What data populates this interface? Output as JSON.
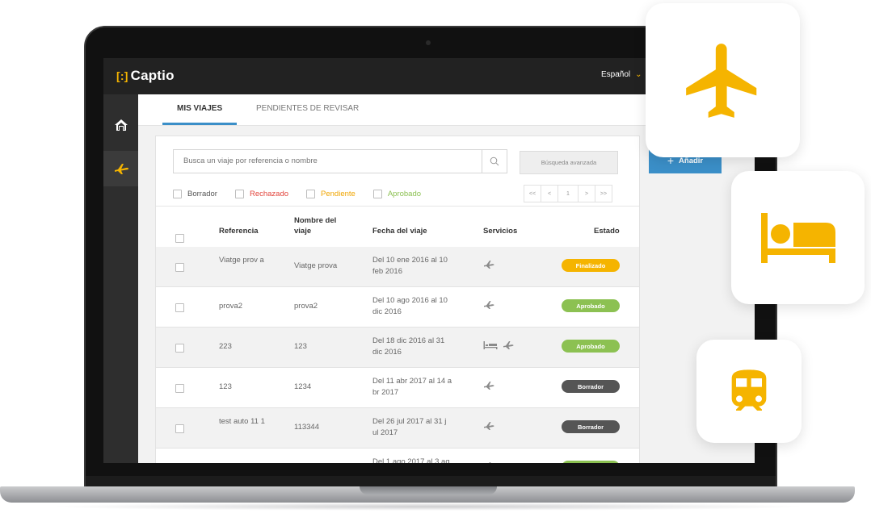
{
  "app": {
    "brand": "Captio",
    "language": "Español"
  },
  "tabs": [
    {
      "label": "MIS VIAJES",
      "active": true
    },
    {
      "label": "PENDIENTES DE REVISAR",
      "active": false
    }
  ],
  "search": {
    "placeholder": "Busca un viaje por referencia o nombre",
    "advanced_label": "Búsqueda avanzada"
  },
  "add_button": {
    "label": "Añadir"
  },
  "filters": [
    {
      "label": "Borrador",
      "color": "#555555"
    },
    {
      "label": "Rechazado",
      "color": "#e2453c"
    },
    {
      "label": "Pendiente",
      "color": "#f0a500"
    },
    {
      "label": "Aprobado",
      "color": "#8cc152"
    }
  ],
  "pagination": {
    "first": "<<",
    "prev": "<",
    "page": "1",
    "next": ">",
    "last": ">>"
  },
  "table": {
    "headers": {
      "reference": "Referencia",
      "name": "Nombre del viaje",
      "date": "Fecha del viaje",
      "services": "Servicios",
      "status": "Estado"
    },
    "rows": [
      {
        "reference": "Viatge prov a",
        "name": "Viatge prova",
        "date": "Del 10 ene 2016 al 10 feb 2016",
        "services": [
          "plane-icon"
        ],
        "status": "Finalizado"
      },
      {
        "reference": "prova2",
        "name": "prova2",
        "date": "Del 10 ago 2016 al 10 dic 2016",
        "services": [
          "plane-icon"
        ],
        "status": "Aprobado"
      },
      {
        "reference": "223",
        "name": "123",
        "date": "Del 18 dic 2016 al 31 dic 2016",
        "services": [
          "bed-icon",
          "plane-icon"
        ],
        "status": "Aprobado"
      },
      {
        "reference": "123",
        "name": "1234",
        "date": "Del 11 abr 2017 al 14 a br 2017",
        "services": [
          "plane-icon"
        ],
        "status": "Borrador"
      },
      {
        "reference": "test auto 11 1",
        "name": "113344",
        "date": "Del 26 jul 2017 al 31 j ul 2017",
        "services": [
          "plane-icon"
        ],
        "status": "Borrador"
      },
      {
        "reference": "",
        "name": "",
        "date": "Del 1 ago 2017 al 3 ag",
        "services": [
          "plane-icon"
        ],
        "status": "Aprobado"
      }
    ]
  },
  "status_colors": {
    "Finalizado": "#f5b400",
    "Aprobado": "#8cc152",
    "Borrador": "#555555"
  },
  "colors": {
    "accent": "#3b8fc8",
    "brand_yellow": "#f5b400",
    "topbar": "#222222"
  },
  "floating_icons": [
    "airplane-icon",
    "hotel-bed-icon",
    "train-icon"
  ]
}
